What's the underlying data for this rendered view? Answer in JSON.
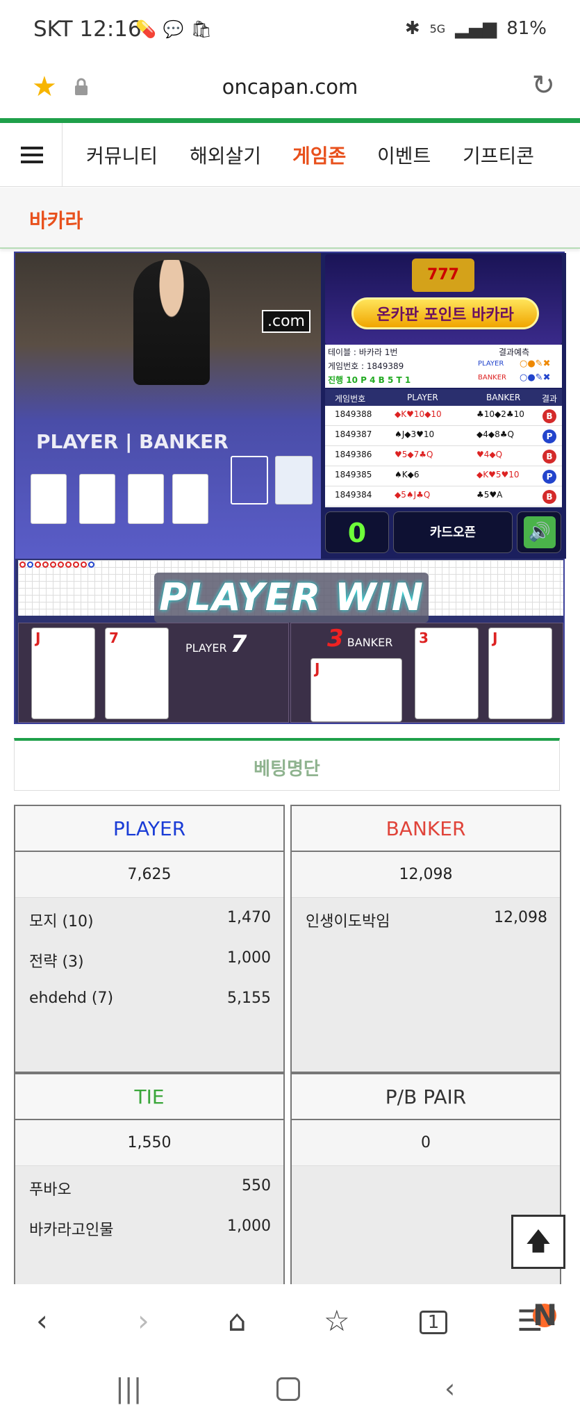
{
  "status_bar": {
    "carrier_time": "SKT 12:16",
    "battery": "81%",
    "network": "5G"
  },
  "browser": {
    "url": "oncapan.com"
  },
  "nav": {
    "items": [
      "커뮤니티",
      "해외살기",
      "게임존",
      "이벤트",
      "기프티콘"
    ],
    "active_index": 2
  },
  "sub_title": "바카라",
  "video": {
    "watermark": ".com",
    "player_banker": "PLAYER | BANKER"
  },
  "banner": {
    "title": "온카판 포인트 바카라",
    "slots": "777"
  },
  "game_info": {
    "table": "테이블 : 바카라 1번",
    "game_no": "게임번호 : 1849389",
    "progress": "진행 10  P 4  B 5  T 1",
    "prediction_label": "결과예측",
    "player_label": "PLAYER",
    "banker_label": "BANKER"
  },
  "results_table": {
    "headers": [
      "게임번호",
      "PLAYER",
      "BANKER",
      "결과"
    ],
    "rows": [
      {
        "no": "1849388",
        "player": "◆K♥10◆10",
        "banker": "♣10◆2♣10",
        "result": "B"
      },
      {
        "no": "1849387",
        "player": "♠J◆3♥10",
        "banker": "◆4◆8♣Q",
        "result": "P"
      },
      {
        "no": "1849386",
        "player": "♥5◆7♣Q",
        "banker": "♥4◆Q",
        "result": "B"
      },
      {
        "no": "1849385",
        "player": "♠K◆6",
        "banker": "◆K♥5♥10",
        "result": "P"
      },
      {
        "no": "1849384",
        "player": "◆5♠J♣Q",
        "banker": "♣5♥A",
        "result": "B"
      }
    ]
  },
  "controls": {
    "count": "0",
    "card_open": "카드오픈"
  },
  "win_text": "PLAYER WIN",
  "hand": {
    "player_label": "PLAYER",
    "player_score": "7",
    "banker_label": "BANKER",
    "banker_score": "3",
    "player_cards": [
      "J",
      "7"
    ],
    "banker_cards": [
      "J",
      "3",
      "J"
    ]
  },
  "betting_title": "베팅명단",
  "bets": {
    "player": {
      "title": "PLAYER",
      "total": "7,625",
      "rows": [
        {
          "name": "모지 (10)",
          "amount": "1,470"
        },
        {
          "name": "전략 (3)",
          "amount": "1,000"
        },
        {
          "name": "ehdehd (7)",
          "amount": "5,155"
        }
      ]
    },
    "banker": {
      "title": "BANKER",
      "total": "12,098",
      "rows": [
        {
          "name": "인생이도박임",
          "amount": "12,098"
        }
      ]
    },
    "tie": {
      "title": "TIE",
      "total": "1,550",
      "rows": [
        {
          "name": "푸바오",
          "amount": "550"
        },
        {
          "name": "바카라고인물",
          "amount": "1,000"
        }
      ]
    },
    "pair": {
      "title": "P/B PAIR",
      "total": "0",
      "rows": []
    }
  },
  "bottom_nav": {
    "tabs_count": "1",
    "menu_badge": "N"
  },
  "colors": {
    "accent_orange": "#e8501c",
    "green": "#1fa04a",
    "player_blue": "#1a3cd6",
    "banker_red": "#e0443a",
    "tie_green": "#3aa63a"
  }
}
